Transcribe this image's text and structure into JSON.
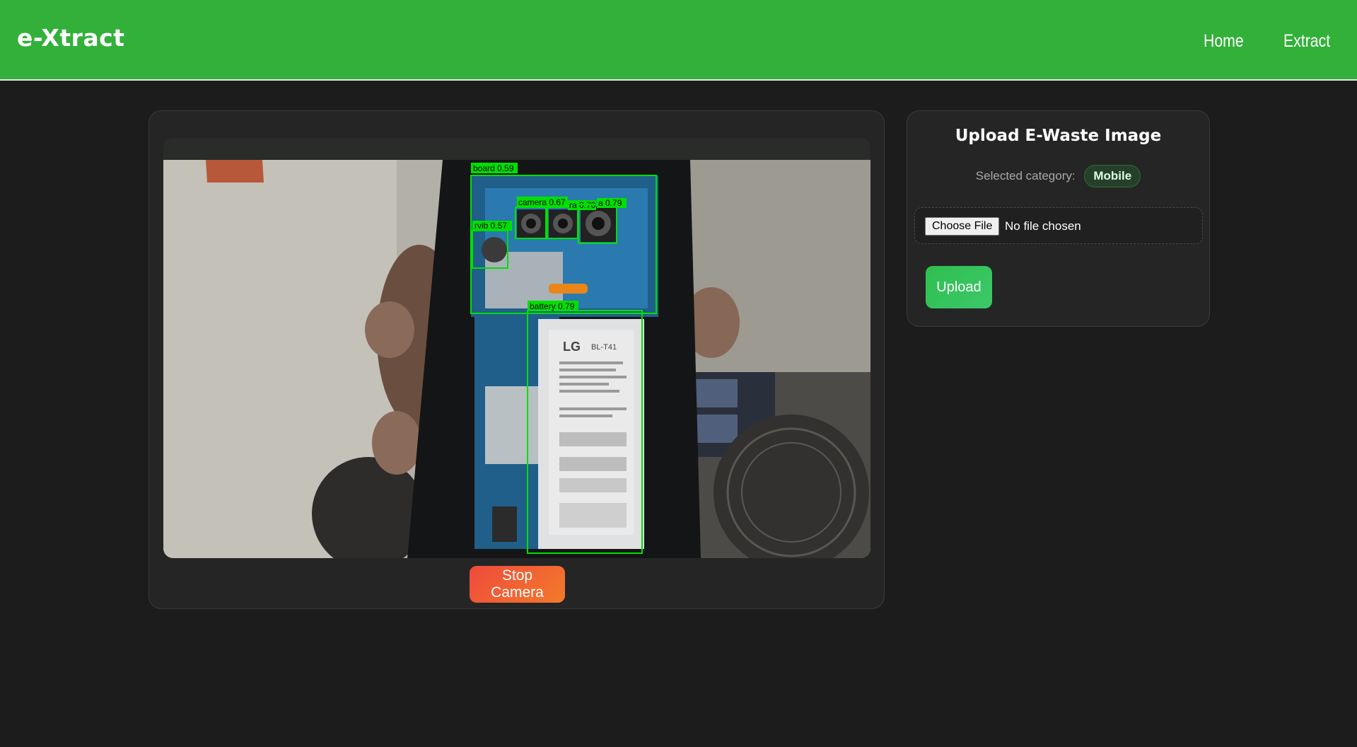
{
  "nav": {
    "brand": "e-Xtract",
    "links": [
      "Home",
      "Extract"
    ],
    "color": "#33b03a"
  },
  "camera": {
    "stop_label": "Stop Camera",
    "detections": [
      {
        "label": "board 0.59"
      },
      {
        "label": "camera 0.67"
      },
      {
        "label": "ra 0.70"
      },
      {
        "label": "a 0.79"
      },
      {
        "label": "rvib 0.57"
      },
      {
        "label": "battery 0.79"
      }
    ],
    "battery_text": {
      "brand": "LG",
      "model": "BL-T41"
    }
  },
  "upload": {
    "title": "Upload E-Waste Image",
    "category_label": "Selected category:",
    "category_value": "Mobile",
    "choose_file_label": "Choose File",
    "file_status": "No file chosen",
    "upload_label": "Upload"
  }
}
